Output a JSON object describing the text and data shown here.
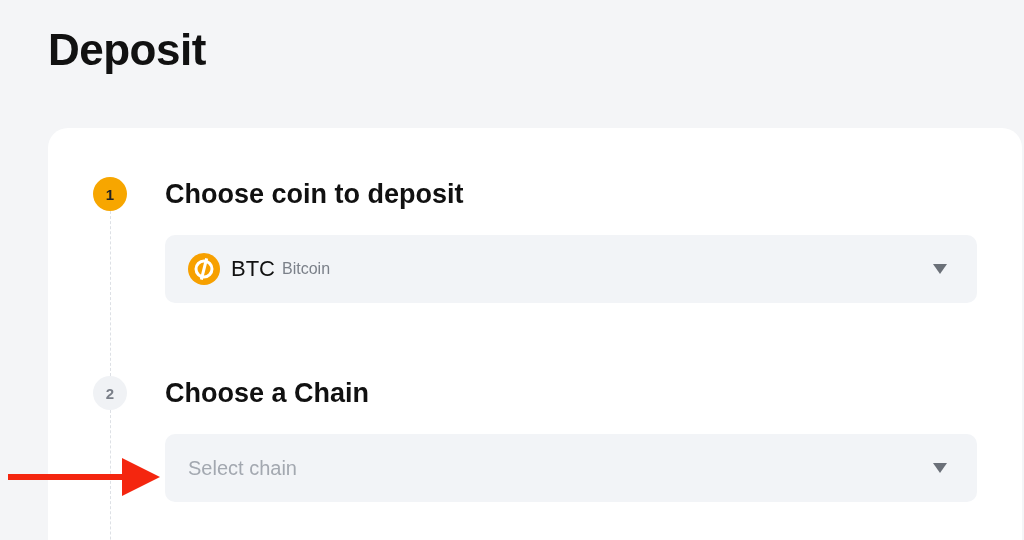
{
  "title": "Deposit",
  "steps": [
    {
      "number": "1",
      "title": "Choose coin to deposit",
      "active": true,
      "field": {
        "kind": "coin",
        "symbol": "BTC",
        "name": "Bitcoin"
      }
    },
    {
      "number": "2",
      "title": "Choose a Chain",
      "active": false,
      "field": {
        "kind": "empty",
        "placeholder": "Select chain"
      }
    }
  ]
}
